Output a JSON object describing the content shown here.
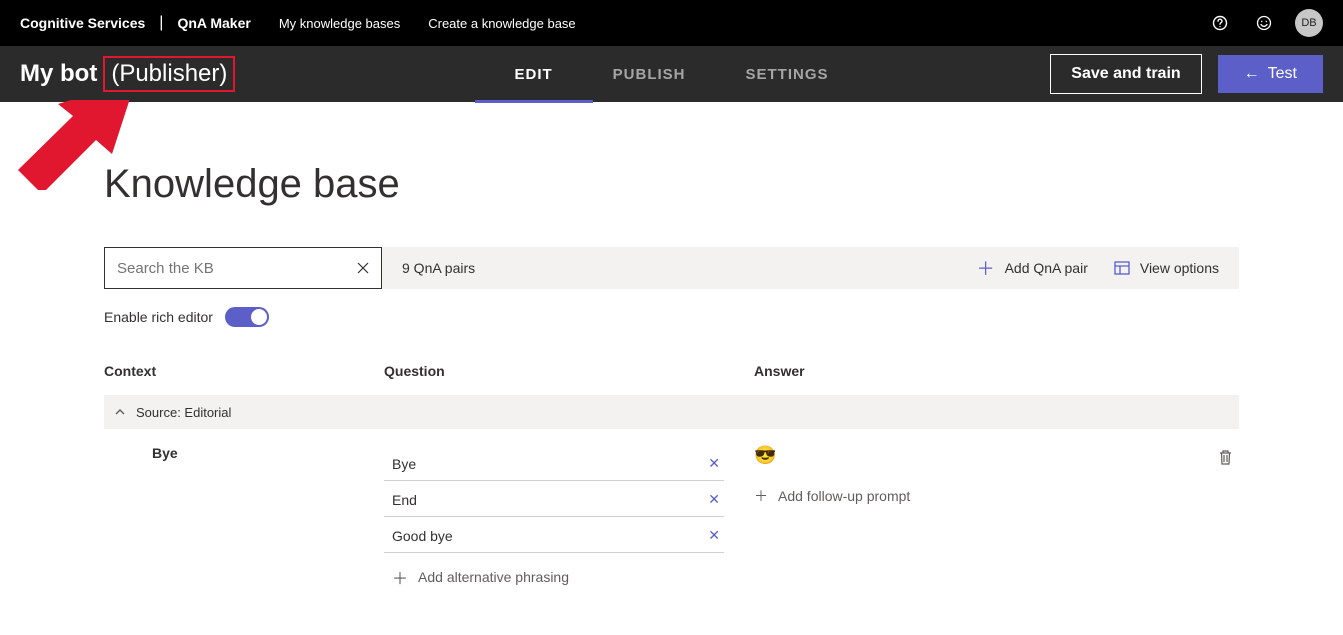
{
  "topbar": {
    "brand1": "Cognitive Services",
    "brand2": "QnA Maker",
    "nav": [
      "My knowledge bases",
      "Create a knowledge base"
    ],
    "avatar": "DB"
  },
  "subheader": {
    "title_main": "My bot",
    "title_role": "(Publisher)",
    "tabs": [
      {
        "label": "EDIT",
        "active": true
      },
      {
        "label": "PUBLISH",
        "active": false
      },
      {
        "label": "SETTINGS",
        "active": false
      }
    ],
    "save_label": "Save and train",
    "test_label": "Test"
  },
  "page": {
    "title": "Knowledge base",
    "search_placeholder": "Search the KB",
    "pair_count": "9 QnA pairs",
    "add_pair": "Add QnA pair",
    "view_options": "View options",
    "toggle_label": "Enable rich editor"
  },
  "columns": {
    "context": "Context",
    "question": "Question",
    "answer": "Answer"
  },
  "source": {
    "label": "Source: Editorial"
  },
  "qna": {
    "context_title": "Bye",
    "phrases": [
      "Bye",
      "End",
      "Good bye"
    ],
    "add_phrase": "Add alternative phrasing",
    "answer_emoji": "😎",
    "followup": "Add follow-up prompt"
  }
}
